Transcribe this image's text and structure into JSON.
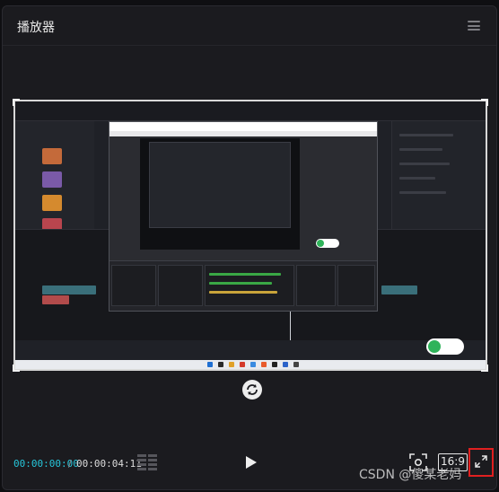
{
  "header": {
    "title": "播放器"
  },
  "player": {
    "time_current": "00:00:00:00",
    "time_separator": "/",
    "time_total": "00:00:04:11",
    "aspect_ratio": "16:9"
  },
  "icons": {
    "menu": "menu-icon",
    "rotate": "rotate-icon",
    "grid": "grid-icon",
    "play": "play-icon",
    "fit": "fit-screen-icon",
    "fullscreen": "fullscreen-icon"
  },
  "watermark": "CSDN @傻某老妈",
  "colors": {
    "accent": "#26c6da",
    "highlight": "#e02020",
    "background": "#1b1b1f"
  }
}
